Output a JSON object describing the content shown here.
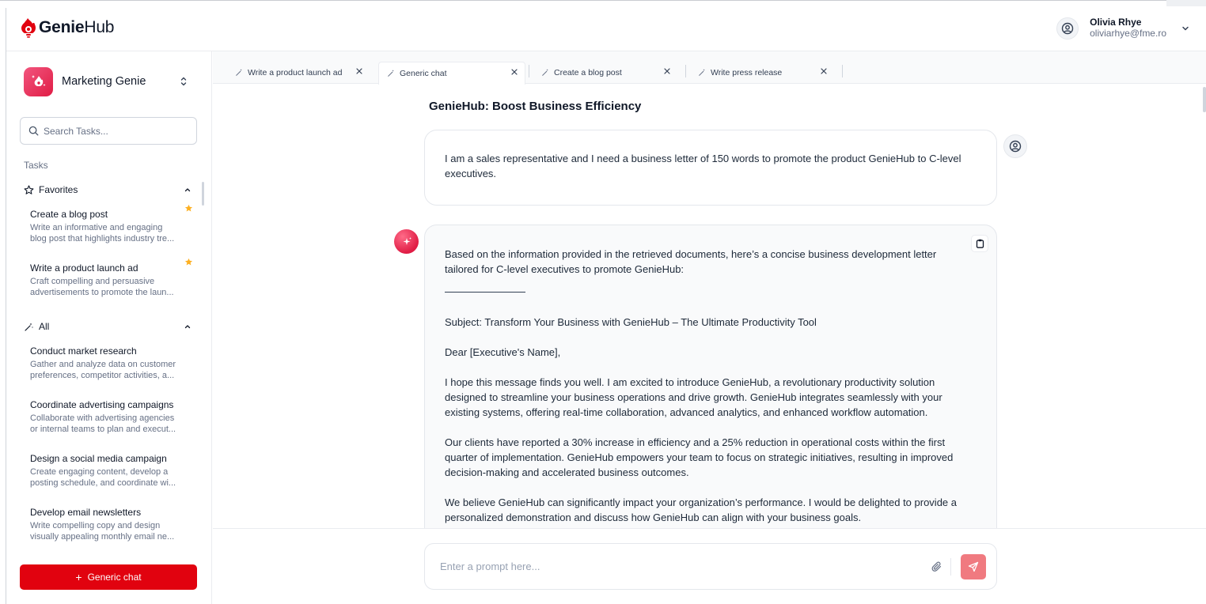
{
  "app": {
    "brand_bold": "Genie",
    "brand_rest": "Hub",
    "brand_color": "#e1020f"
  },
  "user": {
    "name": "Olivia Rhye",
    "email": "oliviarhye@fme.ro",
    "icon": "user-circle-icon"
  },
  "sidebar": {
    "genie_name": "Marketing Genie",
    "search_placeholder": "Search Tasks...",
    "tasks_label": "Tasks",
    "favorites_label": "Favorites",
    "all_label": "All",
    "favorites": [
      {
        "title": "Create a blog post",
        "desc": "Write an informative and engaging blog post that highlights industry tre...",
        "desc1": "Write an informative and engaging",
        "desc2": "blog post that highlights industry tre...",
        "starred": true
      },
      {
        "title": "Write a product launch ad",
        "desc1": "Craft compelling and persuasive",
        "desc2": "advertisements to promote the laun...",
        "starred": true
      }
    ],
    "all": [
      {
        "title": "Conduct market research",
        "desc1": "Gather and analyze data on customer",
        "desc2": "preferences, competitor activities, a..."
      },
      {
        "title": "Coordinate advertising campaigns",
        "desc1": "Collaborate with advertising agencies",
        "desc2": "or internal teams to plan and execut..."
      },
      {
        "title": "Design a social media campaign",
        "desc1": "Create engaging content, develop a",
        "desc2": "posting schedule, and coordinate wi..."
      },
      {
        "title": "Develop email newsletters",
        "desc1": "Write compelling copy and design",
        "desc2": "visually appealing monthly email ne..."
      }
    ],
    "new_chat_label": "Generic chat",
    "new_chat_color": "#e1020f"
  },
  "tabs": [
    {
      "label": "Write a product launch ad",
      "active": false
    },
    {
      "label": "Generic chat",
      "active": true
    },
    {
      "label": "Create a blog post",
      "active": false
    },
    {
      "label": "Write press release",
      "active": false
    }
  ],
  "chat": {
    "title": "GenieHub: Boost Business Efficiency",
    "user_message": "I am a sales representative and I need a business letter of 150 words to promote the product GenieHub to C-level executives.",
    "bot_paragraphs": [
      "Based on the information provided in the retrieved documents, here’s a concise business development letter tailored for C-level executives to promote GenieHub:",
      "Subject: Transform Your Business with GenieHub – The Ultimate Productivity Tool",
      "Dear [Executive's Name],",
      "I hope this message finds you well. I am excited to introduce GenieHub, a revolutionary productivity solution designed to streamline your business operations and drive growth. GenieHub integrates seamlessly with your existing systems, offering real-time collaboration, advanced analytics, and enhanced workflow automation.",
      "Our clients have reported a 30% increase in efficiency and a 25% reduction in operational costs within the first quarter of implementation. GenieHub empowers your team to focus on strategic initiatives, resulting in improved decision-making and accelerated business outcomes.",
      "We believe GenieHub can significantly impact your organization’s performance. I would be delighted to provide a personalized demonstration and discuss how GenieHub can align with your business goals."
    ]
  },
  "composer": {
    "placeholder": "Enter a prompt here...",
    "send_color": "#f07a80"
  }
}
